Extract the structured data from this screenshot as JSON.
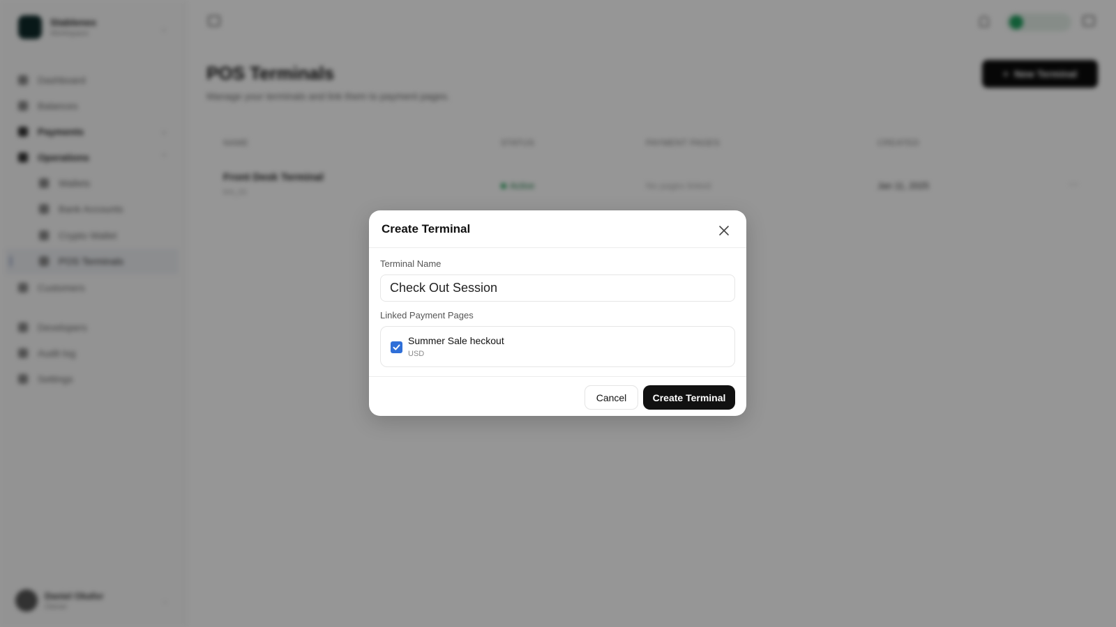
{
  "sidebar": {
    "brand": {
      "name": "Stablenex",
      "subtitle": "Workspace"
    },
    "items": [
      {
        "label": "Dashboard"
      },
      {
        "label": "Balances"
      },
      {
        "label": "Payments"
      },
      {
        "label": "Operations"
      },
      {
        "label": "Wallets"
      },
      {
        "label": "Bank Accounts"
      },
      {
        "label": "Crypto Wallet"
      },
      {
        "label": "POS Terminals"
      },
      {
        "label": "Customers"
      },
      {
        "label": "Developers"
      },
      {
        "label": "Audit log"
      },
      {
        "label": "Settings"
      }
    ],
    "user": {
      "name": "Daniel Okafor",
      "role": "Owner"
    }
  },
  "main": {
    "title": "POS Terminals",
    "subtitle": "Manage your terminals and link them to payment pages.",
    "new_button_label": "New Terminal",
    "table": {
      "headers": [
        "NAME",
        "STATUS",
        "PAYMENT PAGES",
        "CREATED"
      ],
      "rows": [
        {
          "name": "Front Desk Terminal",
          "id": "trm_01",
          "status": "Active",
          "pages": "No pages linked",
          "created": "Jan 11, 2025"
        }
      ]
    }
  },
  "dialog": {
    "title": "Create Terminal",
    "terminal_name_label": "Terminal Name",
    "terminal_name_value": "Check Out Session",
    "linked_pages_label": "Linked Payment Pages",
    "pages": [
      {
        "name": "Summer Sale heckout",
        "currency": "USD",
        "checked": true
      }
    ],
    "cancel_label": "Cancel",
    "create_label": "Create Terminal"
  },
  "colors": {
    "checkbox": "#2f6fd8",
    "primary_button": "#111111",
    "status_active": "#23a35a",
    "overlay": "rgba(0,0,0,0.41)"
  }
}
